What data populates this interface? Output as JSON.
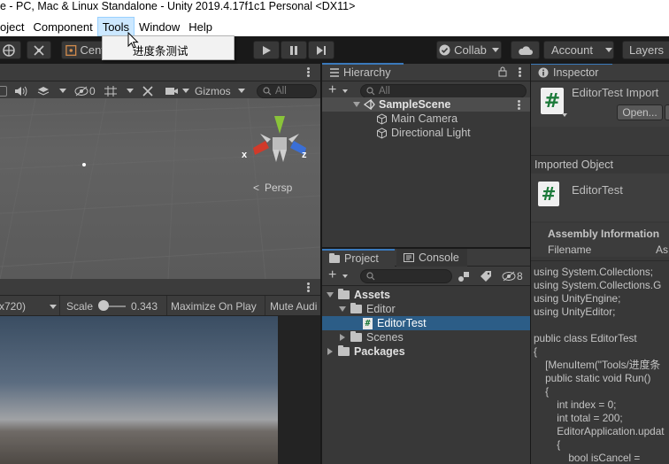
{
  "window": {
    "title": "e - PC, Mac & Linux Standalone - Unity 2019.4.17f1c1 Personal <DX11>"
  },
  "menu": [
    "oject",
    "Component",
    "Tools",
    "Window",
    "Help"
  ],
  "tools_dropdown": {
    "item": "进度条测试"
  },
  "toolbar": {
    "center_label": "Cent",
    "collab_label": "Collab",
    "account_label": "Account",
    "layers_label": "Layers"
  },
  "scene": {
    "gizmos_label": "Gizmos",
    "search_placeholder": "All",
    "persp_label": "Persp",
    "axis_x": "x",
    "axis_z": "z",
    "hidden_count": "0"
  },
  "game": {
    "resolution": "x720)",
    "scale_label": "Scale",
    "scale_value": "0.343",
    "scale_fraction": 0.02,
    "maximize_label": "Maximize On Play",
    "mute_label": "Mute Audi"
  },
  "hierarchy": {
    "tab": "Hierarchy",
    "search_placeholder": "All",
    "scene_name": "SampleScene",
    "items": [
      "Main Camera",
      "Directional Light"
    ]
  },
  "project": {
    "tab_project": "Project",
    "tab_console": "Console",
    "hidden_count": "8",
    "assets": "Assets",
    "editor": "Editor",
    "editor_test": "EditorTest",
    "scenes": "Scenes",
    "packages": "Packages"
  },
  "inspector": {
    "tab": "Inspector",
    "title": "EditorTest Import",
    "open_button": "Open...",
    "imported_object_label": "Imported Object",
    "object_name": "EditorTest",
    "assembly_header": "Assembly Information",
    "filename_label": "Filename",
    "filename_value_partial": "As",
    "code_lines": [
      "using System.Collections;",
      "using System.Collections.G",
      "using UnityEngine;",
      "using UnityEditor;",
      "",
      "public class EditorTest",
      "{",
      "    [MenuItem(\"Tools/进度条",
      "    public static void Run()",
      "    {",
      "        int index = 0;",
      "        int total = 200;",
      "        EditorApplication.updat",
      "        {",
      "            bool isCancel ="
    ]
  },
  "colors": {
    "accent_blue": "#3a79bb",
    "selection": "#2c5d87",
    "panel": "#383838",
    "menu_highlight": "#cce8ff"
  }
}
